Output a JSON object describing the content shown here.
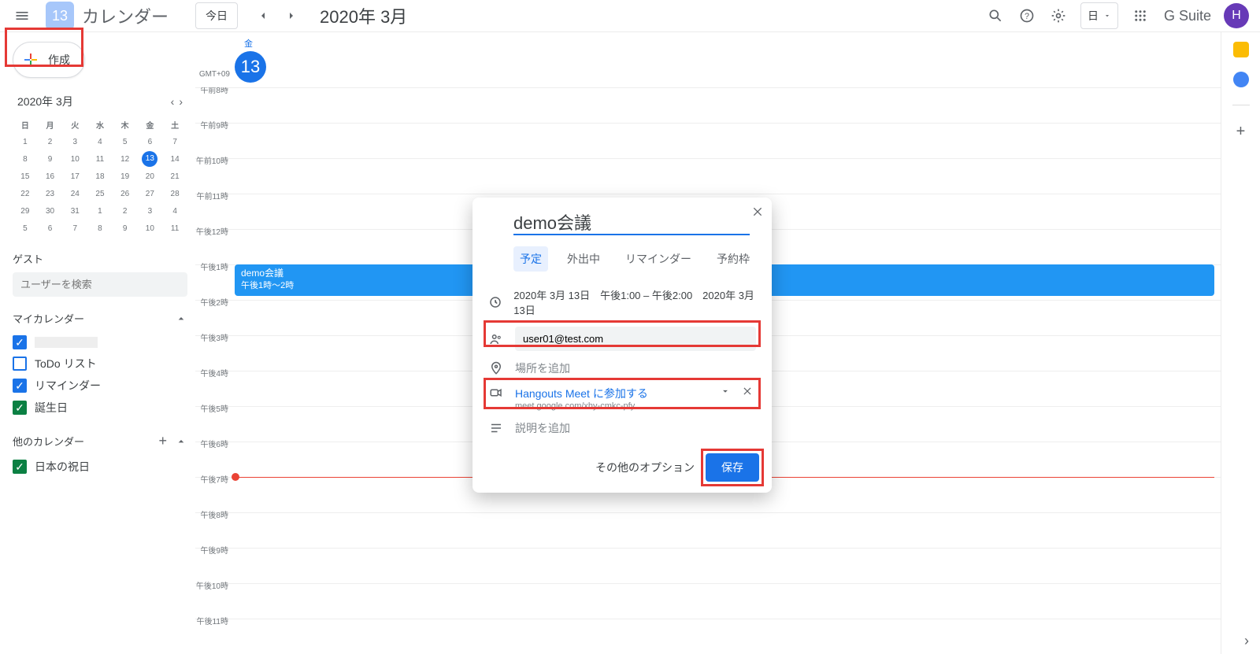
{
  "header": {
    "logo_day": "13",
    "app_title": "カレンダー",
    "today_btn": "今日",
    "current_date": "2020年 3月",
    "view_label": "日",
    "gsuite_label": "G Suite",
    "avatar_letter": "H"
  },
  "sidebar": {
    "create_label": "作成",
    "mini_title": "2020年 3月",
    "weekdays": [
      "日",
      "月",
      "火",
      "水",
      "木",
      "金",
      "土"
    ],
    "weeks": [
      [
        "1",
        "2",
        "3",
        "4",
        "5",
        "6",
        "7"
      ],
      [
        "8",
        "9",
        "10",
        "11",
        "12",
        "13",
        "14"
      ],
      [
        "15",
        "16",
        "17",
        "18",
        "19",
        "20",
        "21"
      ],
      [
        "22",
        "23",
        "24",
        "25",
        "26",
        "27",
        "28"
      ],
      [
        "29",
        "30",
        "31",
        "1",
        "2",
        "3",
        "4"
      ],
      [
        "5",
        "6",
        "7",
        "8",
        "9",
        "10",
        "11"
      ]
    ],
    "today_cell": "13",
    "guest_label": "ゲスト",
    "guest_placeholder": "ユーザーを検索",
    "mycal_label": "マイカレンダー",
    "mycal_items": [
      {
        "label": "",
        "color": "#1a73e8",
        "checked": true,
        "mask": true
      },
      {
        "label": "ToDo リスト",
        "color": "#1a73e8",
        "checked": false
      },
      {
        "label": "リマインダー",
        "color": "#1a73e8",
        "checked": true
      },
      {
        "label": "誕生日",
        "color": "#0b8043",
        "checked": true
      }
    ],
    "othercal_label": "他のカレンダー",
    "othercal_items": [
      {
        "label": "日本の祝日",
        "color": "#0b8043",
        "checked": true
      }
    ]
  },
  "grid": {
    "tz": "GMT+09",
    "day_name": "金",
    "day_num": "13",
    "hours": [
      "午前8時",
      "午前9時",
      "午前10時",
      "午前11時",
      "午後12時",
      "午後1時",
      "午後2時",
      "午後3時",
      "午後4時",
      "午後5時",
      "午後6時",
      "午後7時",
      "午後8時",
      "午後9時",
      "午後10時",
      "午後11時"
    ],
    "event": {
      "title": "demo会議",
      "time": "午後1時～2時",
      "start_index": 5
    },
    "now_index": 11
  },
  "popup": {
    "title": "demo会議",
    "tabs": {
      "event": "予定",
      "ooo": "外出中",
      "reminder": "リマインダー",
      "slots": "予約枠"
    },
    "time_text": "2020年 3月 13日　午後1:00  –  午後2:00　2020年 3月 13日",
    "guest_value": "user01@test.com",
    "location_placeholder": "場所を追加",
    "meet_title": "Hangouts Meet に参加する",
    "meet_url": "meet.google.com/xhy-cmkc-pfy",
    "description_placeholder": "説明を追加",
    "more_options": "その他のオプション",
    "save": "保存"
  }
}
